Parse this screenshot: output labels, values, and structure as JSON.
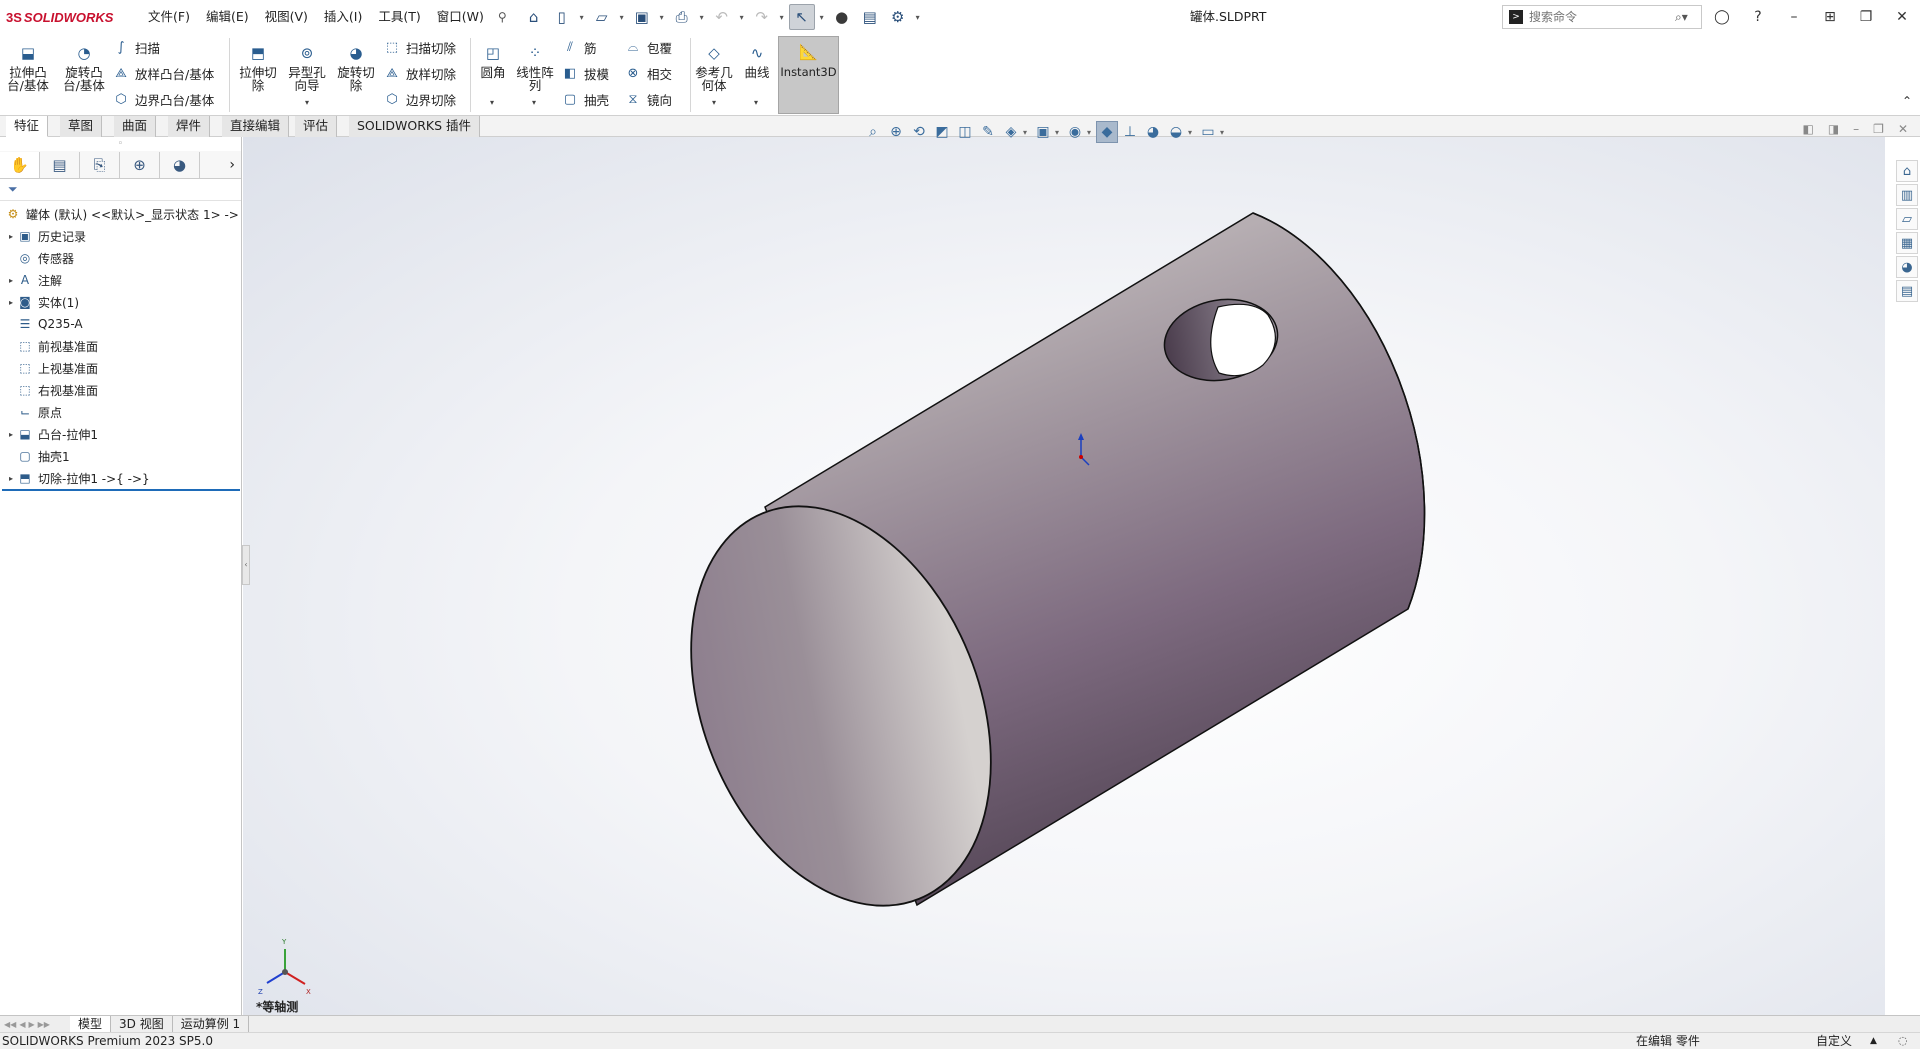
{
  "app": {
    "brand_ds": "3S",
    "brand_name": "SOLIDWORKS",
    "doc_title": "罐体.SLDPRT"
  },
  "menu": [
    {
      "label": "文件(F)"
    },
    {
      "label": "编辑(E)"
    },
    {
      "label": "视图(V)"
    },
    {
      "label": "插入(I)"
    },
    {
      "label": "工具(T)"
    },
    {
      "label": "窗口(W)"
    }
  ],
  "search": {
    "placeholder": "搜索命令"
  },
  "features_toolbar": {
    "extrude_boss": "拉伸凸台/基体",
    "revolve_boss": "旋转凸台/基体",
    "sweep": "扫描",
    "loft_boss": "放样凸台/基体",
    "boundary_boss": "边界凸台/基体",
    "extrude_cut": "拉伸切除",
    "hole_wizard": "异型孔向导",
    "revolve_cut": "旋转切除",
    "sweep_cut": "扫描切除",
    "loft_cut": "放样切除",
    "boundary_cut": "边界切除",
    "fillet": "圆角",
    "linear_pattern": "线性阵列",
    "rib": "筋",
    "draft": "拔模",
    "shell": "抽壳",
    "wrap": "包覆",
    "intersect": "相交",
    "mirror": "镜向",
    "ref_geometry": "参考几何体",
    "curves": "曲线",
    "instant3d": "Instant3D"
  },
  "tabs": [
    {
      "label": "特征"
    },
    {
      "label": "草图"
    },
    {
      "label": "曲面"
    },
    {
      "label": "焊件"
    },
    {
      "label": "直接编辑"
    },
    {
      "label": "评估"
    },
    {
      "label": "SOLIDWORKS 插件"
    }
  ],
  "tree": {
    "root": "罐体 (默认) <<默认>_显示状态 1> ->",
    "items": [
      {
        "label": "历史记录",
        "expandable": true,
        "icon": "history-icon"
      },
      {
        "label": "传感器",
        "expandable": false,
        "icon": "sensor-icon"
      },
      {
        "label": "注解",
        "expandable": true,
        "icon": "annotation-icon"
      },
      {
        "label": "实体(1)",
        "expandable": true,
        "icon": "solid-bodies-icon"
      },
      {
        "label": "Q235-A",
        "expandable": false,
        "icon": "material-icon"
      },
      {
        "label": "前视基准面",
        "expandable": false,
        "icon": "plane-icon"
      },
      {
        "label": "上视基准面",
        "expandable": false,
        "icon": "plane-icon"
      },
      {
        "label": "右视基准面",
        "expandable": false,
        "icon": "plane-icon"
      },
      {
        "label": "原点",
        "expandable": false,
        "icon": "origin-icon"
      },
      {
        "label": "凸台-拉伸1",
        "expandable": true,
        "icon": "extrude-feature-icon"
      },
      {
        "label": "抽壳1",
        "expandable": false,
        "icon": "shell-feature-icon"
      },
      {
        "label": "切除-拉伸1 ->{ ->}",
        "expandable": true,
        "icon": "cut-feature-icon"
      }
    ]
  },
  "viewport": {
    "view_name": "*等轴测",
    "triad": {
      "x": "X",
      "y": "Y",
      "z": "Z"
    }
  },
  "bottom_tabs": [
    {
      "label": "模型"
    },
    {
      "label": "3D 视图"
    },
    {
      "label": "运动算例 1"
    }
  ],
  "status": {
    "product": "SOLIDWORKS Premium 2023 SP5.0",
    "editing": "在编辑 零件",
    "custom": "自定义"
  },
  "colors": {
    "model_face": "#9a8f9c",
    "model_highlight": "#c9c5c6",
    "accent": "#1e6bb8",
    "instant_bg": "#c7c7c7"
  }
}
